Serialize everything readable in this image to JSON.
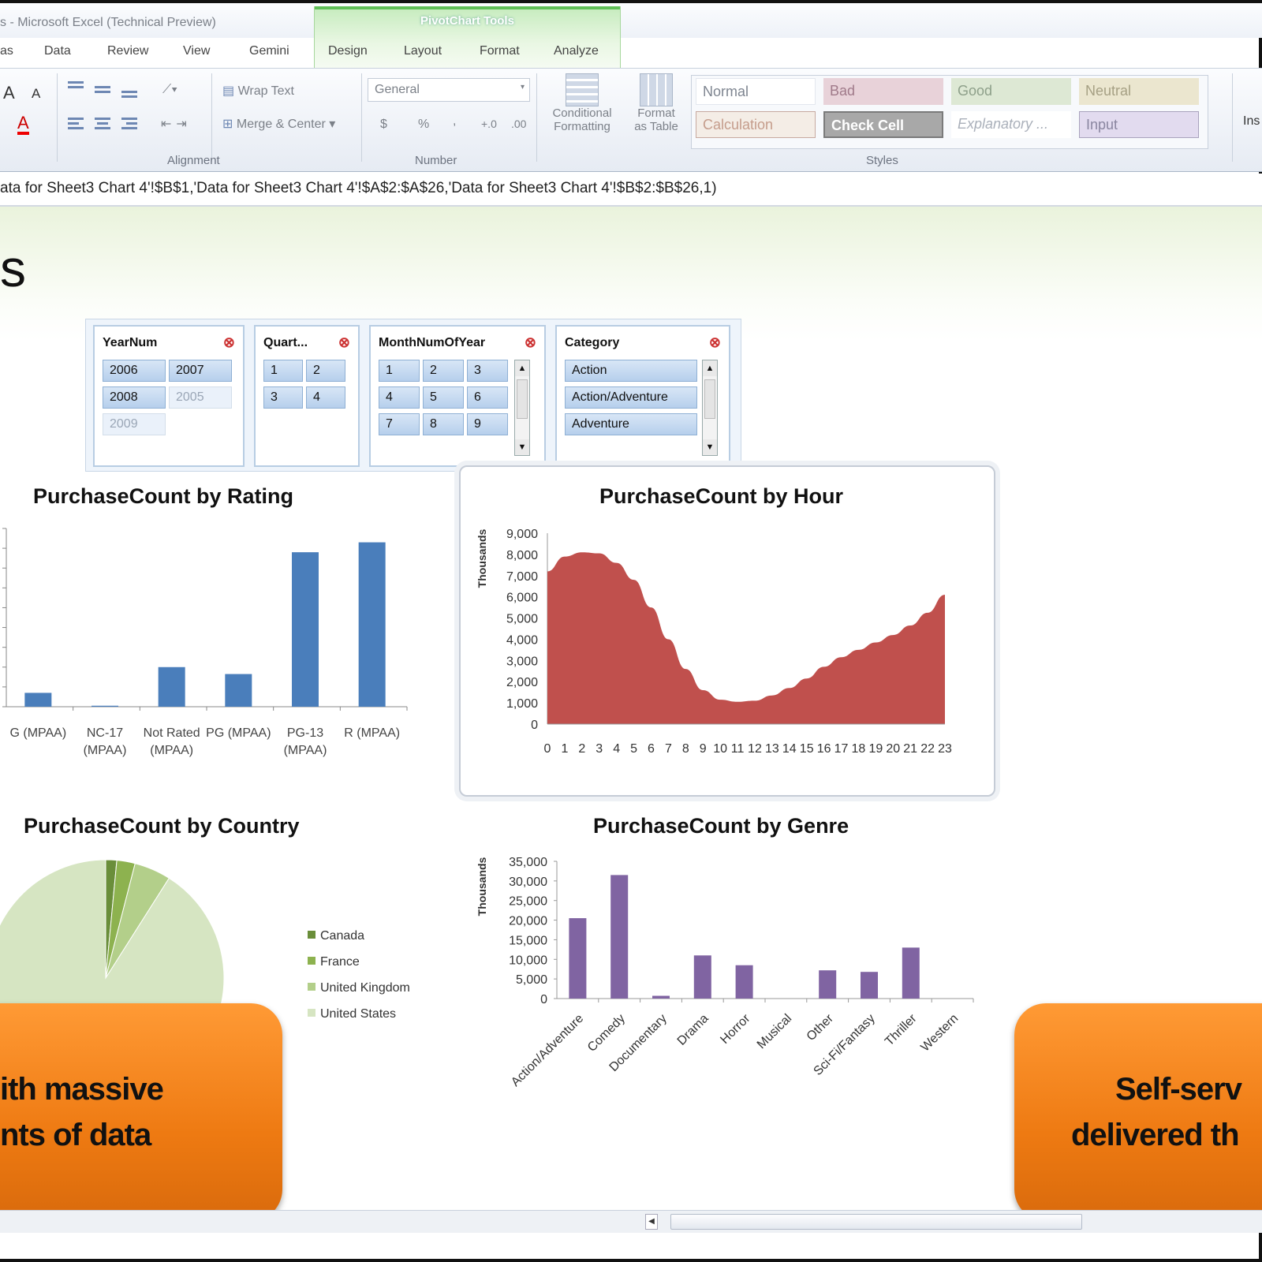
{
  "window": {
    "title": "s - Microsoft Excel (Technical Preview)"
  },
  "contextual_tab": {
    "label": "PivotChart Tools"
  },
  "tabs": [
    "as",
    "Data",
    "Review",
    "View",
    "Gemini",
    "Design",
    "Layout",
    "Format",
    "Analyze"
  ],
  "ribbon": {
    "font": {
      "grow": "A",
      "shrink": "A",
      "color_letter": "A"
    },
    "alignment": {
      "wrap_text": "Wrap Text",
      "merge_center": "Merge & Center",
      "label": "Alignment"
    },
    "number": {
      "format": "General",
      "currency": "$",
      "percent": "%",
      "comma": ",",
      "inc_dec": "+.0",
      "dec_dec": ".00",
      "label": "Number"
    },
    "styles": {
      "conditional_formatting": [
        "Conditional",
        "Formatting"
      ],
      "format_as_table": [
        "Format",
        "as Table"
      ],
      "cells": [
        "Normal",
        "Bad",
        "Good",
        "Neutral",
        "Calculation",
        "Check Cell",
        "Explanatory ...",
        "Input"
      ],
      "label": "Styles"
    },
    "insert": "Ins"
  },
  "formula_bar": {
    "text": "ata for Sheet3 Chart 4'!$B$1,'Data for Sheet3 Chart 4'!$A$2:$A$26,'Data for Sheet3 Chart 4'!$B$2:$B$26,1)"
  },
  "sheet": {
    "heading": "s"
  },
  "slicers": [
    {
      "title": "YearNum",
      "items": [
        {
          "label": "2006",
          "on": true
        },
        {
          "label": "2007",
          "on": true
        },
        {
          "label": "2008",
          "on": true
        },
        {
          "label": "2005",
          "on": false
        },
        {
          "label": "2009",
          "on": false
        }
      ]
    },
    {
      "title": "Quart...",
      "items": [
        {
          "label": "1",
          "on": true
        },
        {
          "label": "2",
          "on": true
        },
        {
          "label": "3",
          "on": true
        },
        {
          "label": "4",
          "on": true
        }
      ]
    },
    {
      "title": "MonthNumOfYear",
      "items": [
        {
          "label": "1",
          "on": true
        },
        {
          "label": "2",
          "on": true
        },
        {
          "label": "3",
          "on": true
        },
        {
          "label": "4",
          "on": true
        },
        {
          "label": "5",
          "on": true
        },
        {
          "label": "6",
          "on": true
        },
        {
          "label": "7",
          "on": true
        },
        {
          "label": "8",
          "on": true
        },
        {
          "label": "9",
          "on": true
        }
      ]
    },
    {
      "title": "Category",
      "items": [
        {
          "label": "Action",
          "on": true
        },
        {
          "label": "Action/Adventure",
          "on": true
        },
        {
          "label": "Adventure",
          "on": true
        }
      ]
    }
  ],
  "chart_data": [
    {
      "type": "bar",
      "title": "PurchaseCount by Rating",
      "categories": [
        "G (MPAA)",
        "NC-17 (MPAA)",
        "Not Rated (MPAA)",
        "PG (MPAA)",
        "PG-13 (MPAA)",
        "R (MPAA)"
      ],
      "category_lines": [
        [
          "G (MPAA)"
        ],
        [
          "NC-17",
          "(MPAA)"
        ],
        [
          "Not Rated",
          "(MPAA)"
        ],
        [
          "PG (MPAA)"
        ],
        [
          "PG-13",
          "(MPAA)"
        ],
        [
          "R (MPAA)"
        ]
      ],
      "values": [
        700,
        50,
        2000,
        1650,
        7800,
        8300
      ],
      "ylim": [
        0,
        9000
      ],
      "color": "#4a7ebb"
    },
    {
      "type": "area",
      "title": "PurchaseCount by Hour",
      "ylabel": "Thousands",
      "x": [
        0,
        1,
        2,
        3,
        4,
        5,
        6,
        7,
        8,
        9,
        10,
        11,
        12,
        13,
        14,
        15,
        16,
        17,
        18,
        19,
        20,
        21,
        22,
        23
      ],
      "values": [
        7200,
        7900,
        8100,
        8050,
        7600,
        6800,
        5500,
        4000,
        2600,
        1600,
        1150,
        1050,
        1100,
        1350,
        1700,
        2150,
        2700,
        3150,
        3500,
        3850,
        4200,
        4650,
        5250,
        6100
      ],
      "yticks": [
        "0",
        "1,000",
        "2,000",
        "3,000",
        "4,000",
        "5,000",
        "6,000",
        "7,000",
        "8,000",
        "9,000"
      ],
      "ylim": [
        0,
        9000
      ],
      "color": "#c0504d"
    },
    {
      "type": "pie",
      "title": "PurchaseCount by Country",
      "categories": [
        "Canada",
        "France",
        "United Kingdom",
        "United States"
      ],
      "values": [
        1.5,
        2.5,
        5,
        91
      ],
      "colors": [
        "#6a8e3a",
        "#8db24f",
        "#b3cf8a",
        "#d6e5c2"
      ],
      "legend": "right"
    },
    {
      "type": "bar",
      "title": "PurchaseCount by Genre",
      "ylabel": "Thousands",
      "categories": [
        "Action/Adventure",
        "Comedy",
        "Documentary",
        "Drama",
        "Horror",
        "Musical",
        "Other",
        "Sci-Fi/Fantasy",
        "Thriller",
        "Western"
      ],
      "values": [
        20500,
        31500,
        700,
        11000,
        8500,
        0,
        7200,
        6800,
        13000,
        0
      ],
      "yticks": [
        "0",
        "5,000",
        "10,000",
        "15,000",
        "20,000",
        "25,000",
        "30,000",
        "35,000"
      ],
      "ylim": [
        0,
        35000
      ],
      "color": "#8064a2"
    }
  ],
  "callouts": {
    "left": [
      "ith massive",
      "nts of data"
    ],
    "right": [
      "Self-serv",
      "delivered th"
    ]
  }
}
